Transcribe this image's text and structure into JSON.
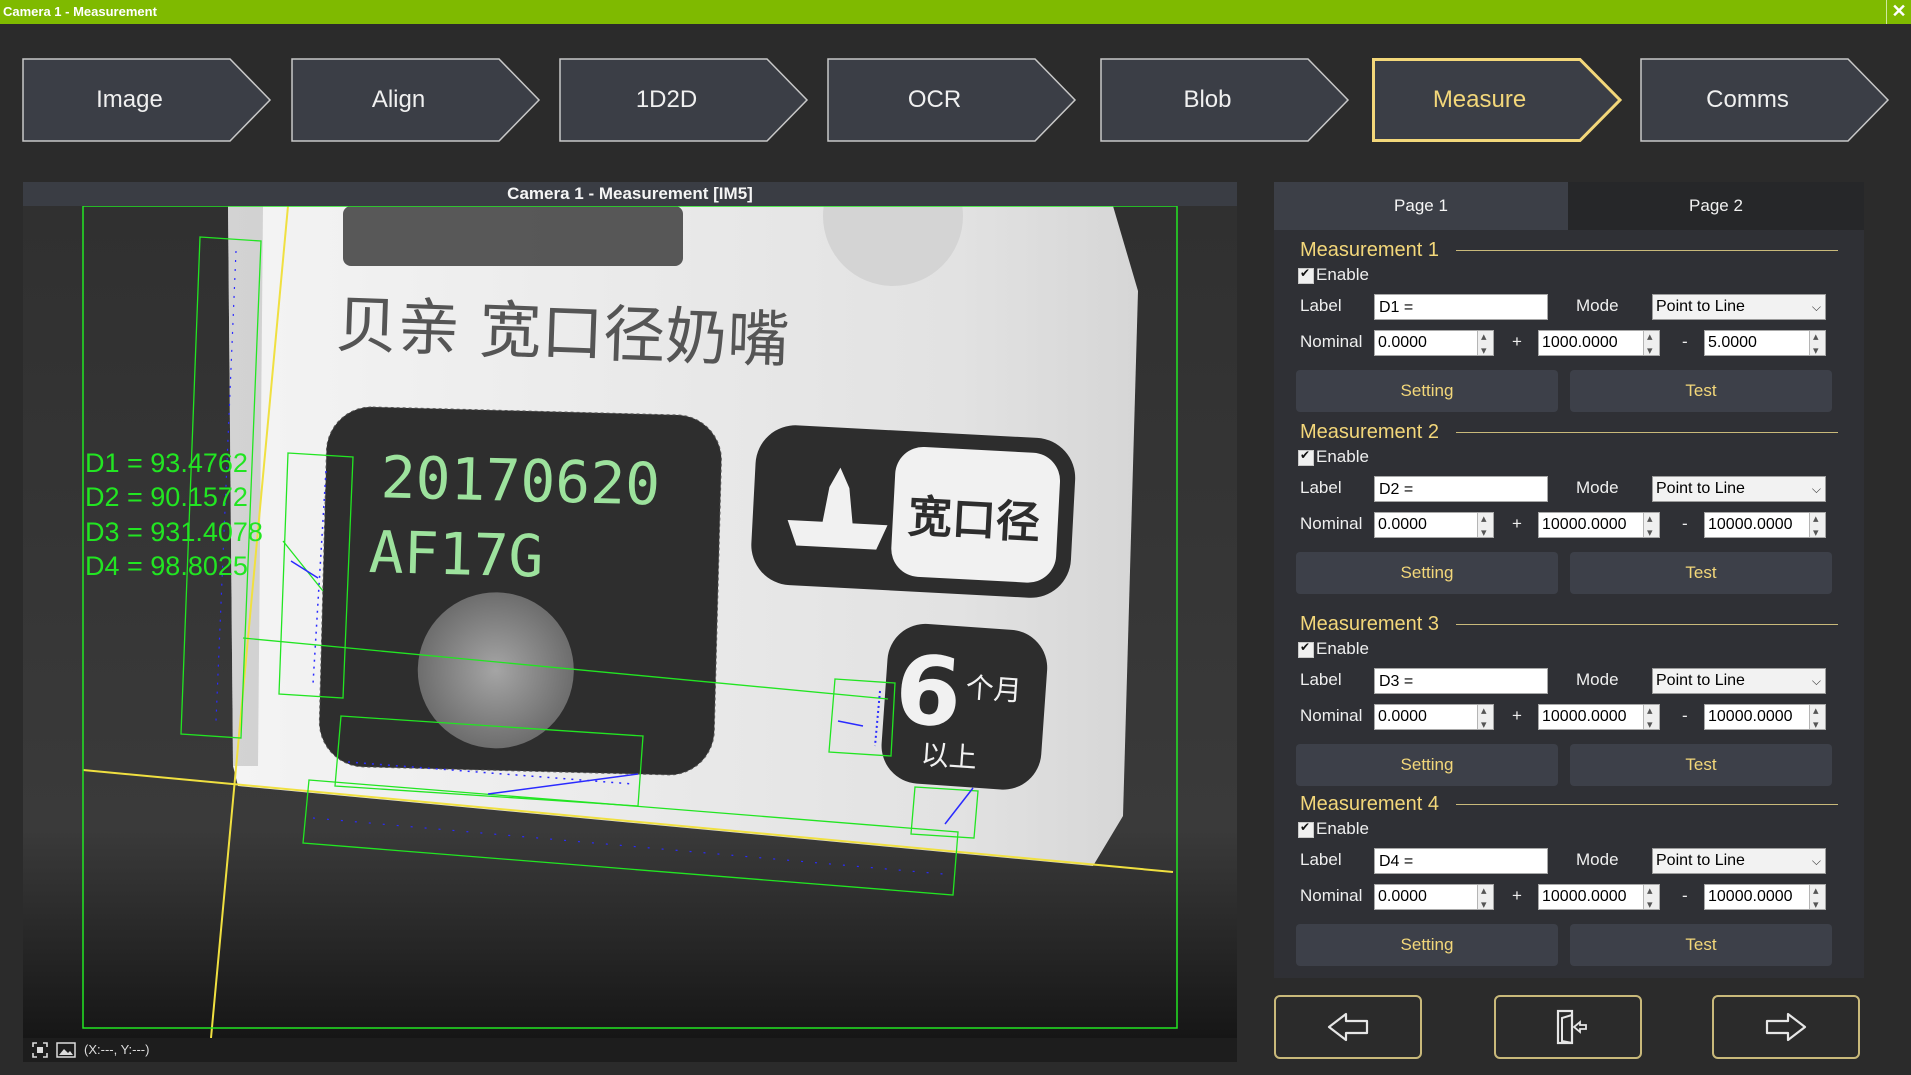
{
  "window": {
    "title": "Camera 1 - Measurement",
    "close_glyph": "✕"
  },
  "steps": [
    {
      "label": "Image",
      "active": false
    },
    {
      "label": "Align",
      "active": false
    },
    {
      "label": "1D2D",
      "active": false
    },
    {
      "label": "OCR",
      "active": false
    },
    {
      "label": "Blob",
      "active": false
    },
    {
      "label": "Measure",
      "active": true
    },
    {
      "label": "Comms",
      "active": false
    }
  ],
  "viewer": {
    "title": "Camera 1 -  Measurement  [IM5]",
    "results": [
      "D1 = 93.4762",
      "D2 = 90.1572",
      "D3 = 931.4078",
      "D4 = 98.8025"
    ],
    "image_text": {
      "line1": "贝亲  宽口径奶嘴",
      "date": "20170620",
      "code": "AF17G",
      "badge": "宽口径",
      "age_num": "6",
      "age_unit": "个月",
      "age_above": "以上"
    },
    "status_coords": "(X:---, Y:---)"
  },
  "tabs": [
    {
      "label": "Page 1",
      "active": true
    },
    {
      "label": "Page 2",
      "active": false
    }
  ],
  "labels": {
    "enable": "Enable",
    "label": "Label",
    "mode": "Mode",
    "nominal": "Nominal",
    "plus": "+",
    "minus": "-",
    "setting": "Setting",
    "test": "Test"
  },
  "measurements": [
    {
      "title": "Measurement 1",
      "enabled": true,
      "label": "D1 =",
      "mode": "Point to Line",
      "nominal": "0.0000",
      "plus": "1000.0000",
      "minus": "5.0000"
    },
    {
      "title": "Measurement 2",
      "enabled": true,
      "label": "D2 =",
      "mode": "Point to Line",
      "nominal": "0.0000",
      "plus": "10000.0000",
      "minus": "10000.0000"
    },
    {
      "title": "Measurement 3",
      "enabled": true,
      "label": "D3 =",
      "mode": "Point to Line",
      "nominal": "0.0000",
      "plus": "10000.0000",
      "minus": "10000.0000"
    },
    {
      "title": "Measurement 4",
      "enabled": true,
      "label": "D4 =",
      "mode": "Point to Line",
      "nominal": "0.0000",
      "plus": "10000.0000",
      "minus": "10000.0000"
    }
  ],
  "nav": {
    "prev_icon": "arrow-left-icon",
    "exit_icon": "exit-door-icon",
    "next_icon": "arrow-right-icon"
  },
  "colors": {
    "titlebar": "#7fba00",
    "accent": "#f3d77a",
    "overlay_green": "#22e522",
    "overlay_yellow": "#f0e040",
    "overlay_blue": "#2a2aff"
  }
}
